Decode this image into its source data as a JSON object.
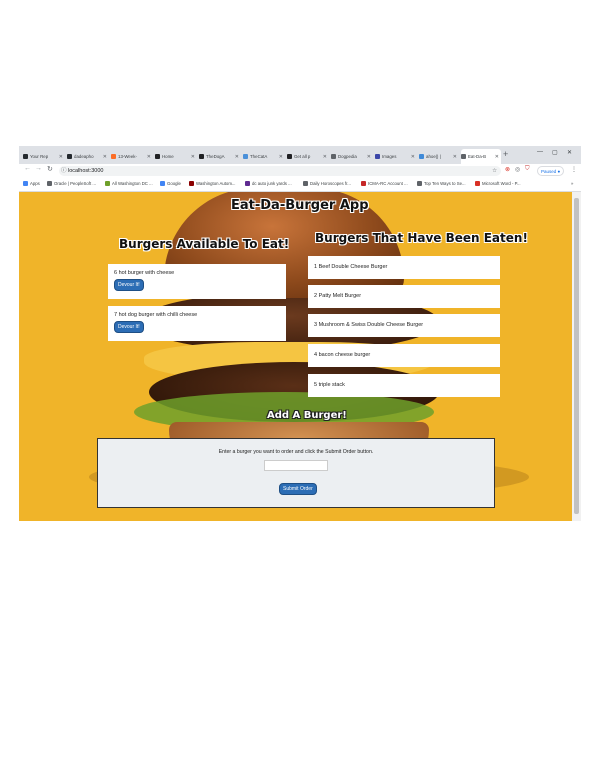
{
  "browser": {
    "tabs": [
      {
        "label": "Your Rep",
        "color": "#24292e"
      },
      {
        "label": "dadeapho",
        "color": "#24292e"
      },
      {
        "label": "13-Week-",
        "color": "#fc6d26"
      },
      {
        "label": "Home",
        "color": "#202124"
      },
      {
        "label": "TheDogA",
        "color": "#202124"
      },
      {
        "label": "TheCatA",
        "color": "#4a90d9"
      },
      {
        "label": "Get all p",
        "color": "#202124"
      },
      {
        "label": "Dogpedia",
        "color": "#5f6368"
      },
      {
        "label": "Images",
        "color": "#3b46a8"
      },
      {
        "label": "ahoe|) |",
        "color": "#3f8ad8"
      },
      {
        "label": "Eat-Da-B",
        "color": "#5f6368"
      }
    ],
    "url": "localhost:3000",
    "profile_label": "Paused",
    "bookmarks": [
      {
        "label": "Apps",
        "color": "#4285f4"
      },
      {
        "label": "Oracle | PeopleSoft ...",
        "color": "#5f6368"
      },
      {
        "label": "All Washington DC ...",
        "color": "#6fa02a"
      },
      {
        "label": "Google",
        "color": "#4285f4"
      },
      {
        "label": "Washington Autom...",
        "color": "#8b0000"
      },
      {
        "label": "dc auto junk yards ...",
        "color": "#5f2b91"
      },
      {
        "label": "Daily Horoscopes fr...",
        "color": "#5f6368"
      },
      {
        "label": "ICMA-RC Account ...",
        "color": "#c62828"
      },
      {
        "label": "Top Ten Ways to Se...",
        "color": "#5f6368"
      },
      {
        "label": "Microsoft Word - P...",
        "color": "#d93025"
      }
    ]
  },
  "app": {
    "title": "Eat-Da-Burger App",
    "available_heading": "Burgers Available To Eat!",
    "eaten_heading": "Burgers That Have Been Eaten!",
    "add_heading": "Add A Burger!",
    "devour_label": "Devour It!",
    "available": [
      {
        "label": "6 hot burger with cheese"
      },
      {
        "label": "7 hot dog burger with chilli cheese"
      }
    ],
    "eaten": [
      {
        "label": "1 Beef Double Cheese Burger"
      },
      {
        "label": "2 Patty Melt Burger"
      },
      {
        "label": "3 Mushroom & Swiss Double Cheese Burger"
      },
      {
        "label": "4 bacon cheese burger"
      },
      {
        "label": "5 triple stack"
      }
    ],
    "form_instruction": "Enter a burger you want to order and click the Submit Order button.",
    "input_value": "",
    "submit_label": "Submit Order"
  }
}
